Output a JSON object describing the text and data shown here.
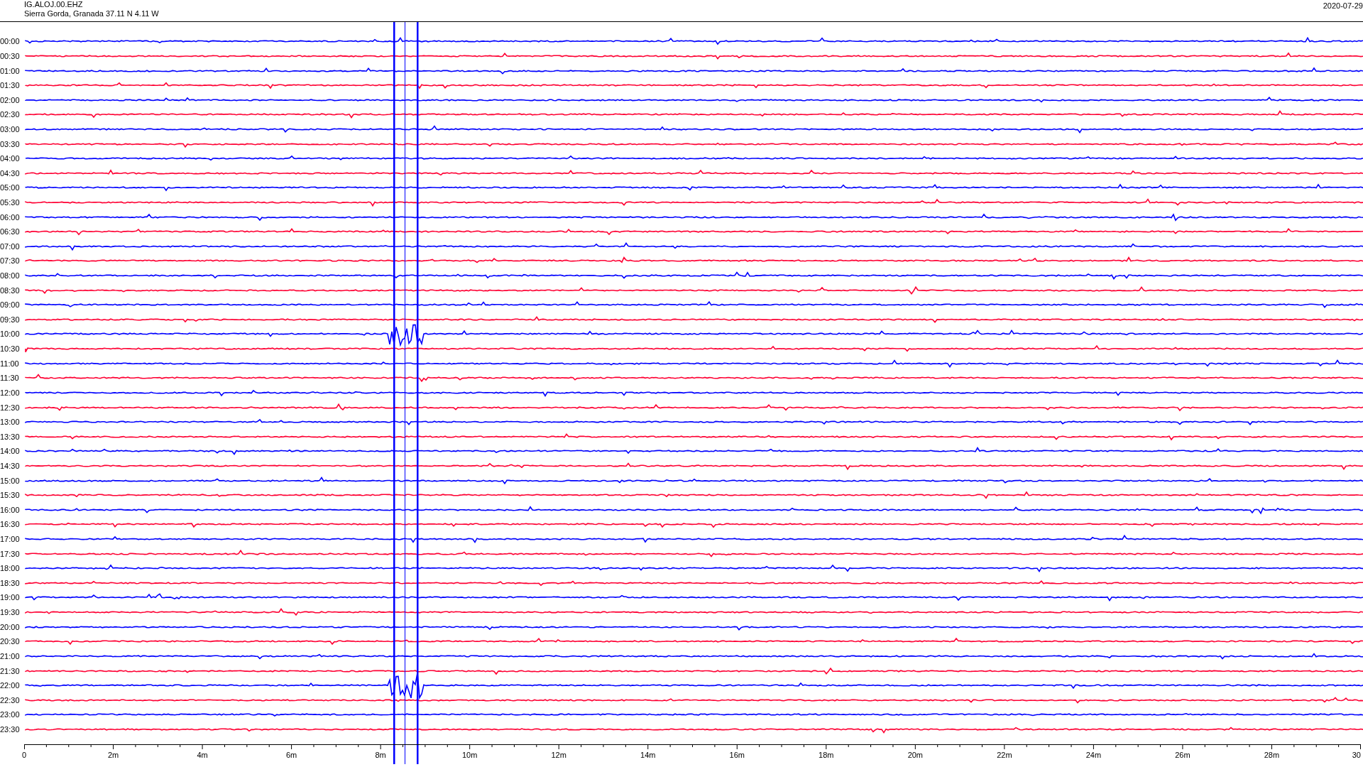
{
  "header": {
    "station": "IG.ALOJ.00.EHZ",
    "location": "Sierra Gorda, Granada  37.11 N 4.11 W",
    "date": "2020-07-29"
  },
  "traces": [
    {
      "time": "00:00",
      "color": "#0000ff",
      "burst": false
    },
    {
      "time": "00:30",
      "color": "#ff0033",
      "burst": false
    },
    {
      "time": "01:00",
      "color": "#0000ff",
      "burst": false
    },
    {
      "time": "01:30",
      "color": "#ff0033",
      "burst": false
    },
    {
      "time": "02:00",
      "color": "#0000ff",
      "burst": false
    },
    {
      "time": "02:30",
      "color": "#ff0033",
      "burst": false
    },
    {
      "time": "03:00",
      "color": "#0000ff",
      "burst": false
    },
    {
      "time": "03:30",
      "color": "#ff0033",
      "burst": false
    },
    {
      "time": "04:00",
      "color": "#0000ff",
      "burst": false
    },
    {
      "time": "04:30",
      "color": "#ff0033",
      "burst": false
    },
    {
      "time": "05:00",
      "color": "#0000ff",
      "burst": false
    },
    {
      "time": "05:30",
      "color": "#ff0033",
      "burst": false
    },
    {
      "time": "06:00",
      "color": "#0000ff",
      "burst": false
    },
    {
      "time": "06:30",
      "color": "#ff0033",
      "burst": false
    },
    {
      "time": "07:00",
      "color": "#0000ff",
      "burst": false
    },
    {
      "time": "07:30",
      "color": "#ff0033",
      "burst": false
    },
    {
      "time": "08:00",
      "color": "#0000ff",
      "burst": false
    },
    {
      "time": "08:30",
      "color": "#ff0033",
      "burst": false
    },
    {
      "time": "09:00",
      "color": "#0000ff",
      "burst": false
    },
    {
      "time": "09:30",
      "color": "#ff0033",
      "burst": false
    },
    {
      "time": "10:00",
      "color": "#0000ff",
      "burst": true
    },
    {
      "time": "10:30",
      "color": "#ff0033",
      "burst": false
    },
    {
      "time": "11:00",
      "color": "#0000ff",
      "burst": false
    },
    {
      "time": "11:30",
      "color": "#ff0033",
      "burst": false
    },
    {
      "time": "12:00",
      "color": "#0000ff",
      "burst": false
    },
    {
      "time": "12:30",
      "color": "#ff0033",
      "burst": false
    },
    {
      "time": "13:00",
      "color": "#0000ff",
      "burst": false
    },
    {
      "time": "13:30",
      "color": "#ff0033",
      "burst": false
    },
    {
      "time": "14:00",
      "color": "#0000ff",
      "burst": false
    },
    {
      "time": "14:30",
      "color": "#ff0033",
      "burst": false
    },
    {
      "time": "15:00",
      "color": "#0000ff",
      "burst": false
    },
    {
      "time": "15:30",
      "color": "#ff0033",
      "burst": false
    },
    {
      "time": "16:00",
      "color": "#0000ff",
      "burst": false
    },
    {
      "time": "16:30",
      "color": "#ff0033",
      "burst": false
    },
    {
      "time": "17:00",
      "color": "#0000ff",
      "burst": false
    },
    {
      "time": "17:30",
      "color": "#ff0033",
      "burst": false
    },
    {
      "time": "18:00",
      "color": "#0000ff",
      "burst": false
    },
    {
      "time": "18:30",
      "color": "#ff0033",
      "burst": false
    },
    {
      "time": "19:00",
      "color": "#0000ff",
      "burst": false
    },
    {
      "time": "19:30",
      "color": "#ff0033",
      "burst": false
    },
    {
      "time": "20:00",
      "color": "#0000ff",
      "burst": false
    },
    {
      "time": "20:30",
      "color": "#ff0033",
      "burst": false
    },
    {
      "time": "21:00",
      "color": "#0000ff",
      "burst": false
    },
    {
      "time": "21:30",
      "color": "#ff0033",
      "burst": false
    },
    {
      "time": "22:00",
      "color": "#0000ff",
      "burst": true
    },
    {
      "time": "22:30",
      "color": "#ff0033",
      "burst": false
    },
    {
      "time": "23:00",
      "color": "#0000ff",
      "burst": false
    },
    {
      "time": "23:30",
      "color": "#ff0033",
      "burst": false
    }
  ],
  "time_axis": [
    "0",
    "2m",
    "4m",
    "6m",
    "8m",
    "10m",
    "12m",
    "14m",
    "16m",
    "18m",
    "20m",
    "22m",
    "24m",
    "26m",
    "28m",
    "30"
  ]
}
